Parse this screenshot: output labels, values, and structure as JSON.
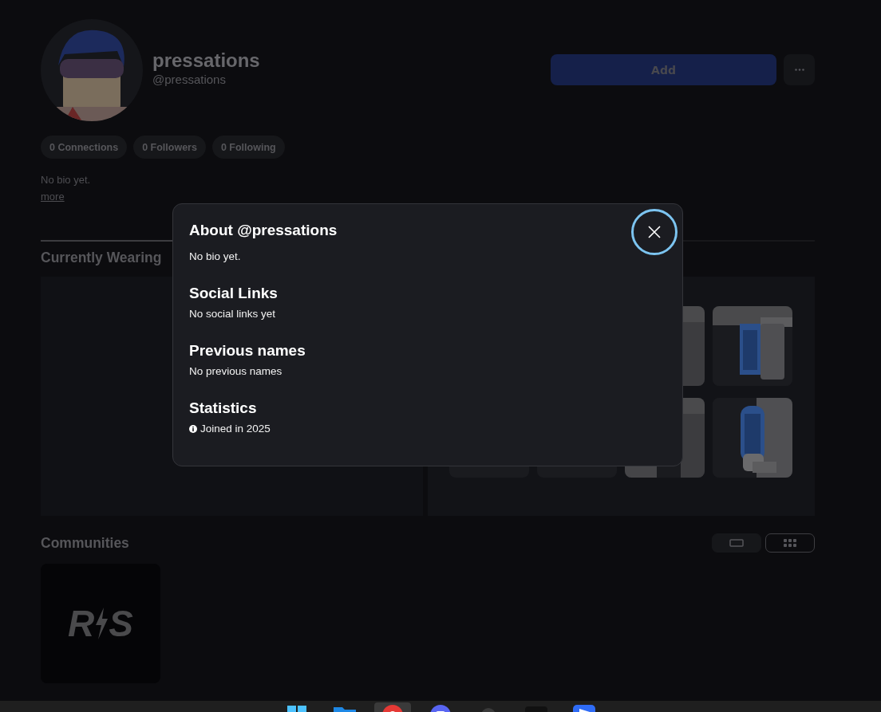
{
  "profile": {
    "display_name": "pressations",
    "username": "@pressations",
    "add_button": "Add"
  },
  "stats": [
    "0 Connections",
    "0 Followers",
    "0 Following"
  ],
  "bio": "No bio yet.",
  "more_link": "more",
  "wearing": {
    "title": "Currently Wearing"
  },
  "communities": {
    "title": "Communities",
    "view_toggle": [
      {
        "selected": false
      },
      {
        "selected": true
      }
    ],
    "items": [
      {
        "logo_left": "R",
        "logo_right": "S"
      }
    ]
  },
  "dialog": {
    "title": "About @pressations",
    "bio": "No bio yet.",
    "sections": [
      {
        "kind": "plain",
        "heading": "Social Links",
        "text": "No social links yet"
      },
      {
        "kind": "plain",
        "heading": "Previous names",
        "text": "No previous names"
      },
      {
        "kind": "info",
        "heading": "Statistics",
        "text": "Joined in 2025"
      }
    ]
  },
  "taskbar": {
    "apps": [
      {
        "kind": "windows",
        "selected": false
      },
      {
        "kind": "folder",
        "selected": false
      },
      {
        "kind": "browser",
        "selected": true
      },
      {
        "kind": "chat",
        "selected": false
      },
      {
        "kind": "gray",
        "selected": false
      },
      {
        "kind": "dark",
        "selected": false
      },
      {
        "kind": "blue",
        "selected": false
      }
    ]
  }
}
